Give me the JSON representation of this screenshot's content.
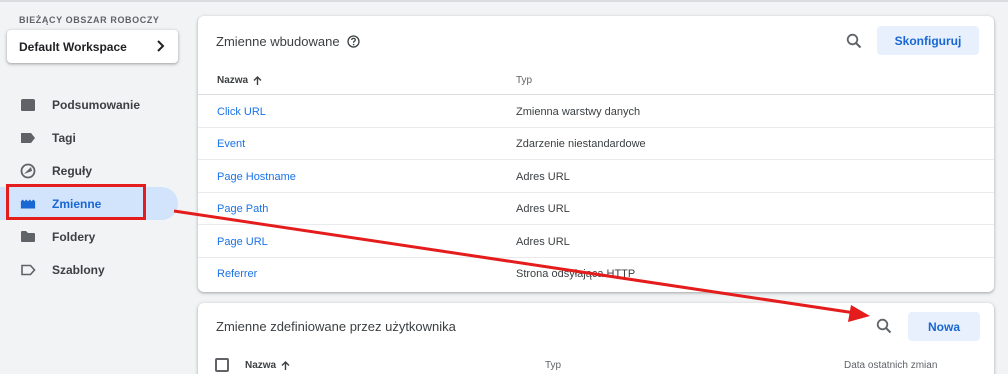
{
  "sidebar": {
    "workspace_label": "BIEŻĄCY OBSZAR ROBOCZY",
    "workspace_name": "Default Workspace",
    "items": [
      {
        "label": "Podsumowanie",
        "icon": "folder-filled-icon"
      },
      {
        "label": "Tagi",
        "icon": "tag-icon"
      },
      {
        "label": "Reguły",
        "icon": "trigger-icon"
      },
      {
        "label": "Zmienne",
        "icon": "variables-icon",
        "active": true
      },
      {
        "label": "Foldery",
        "icon": "folder-icon"
      },
      {
        "label": "Szablony",
        "icon": "template-label-icon"
      }
    ]
  },
  "builtin": {
    "title": "Zmienne wbudowane",
    "configure_label": "Skonfiguruj",
    "columns": {
      "name": "Nazwa",
      "type": "Typ"
    },
    "rows": [
      {
        "name": "Click URL",
        "type": "Zmienna warstwy danych"
      },
      {
        "name": "Event",
        "type": "Zdarzenie niestandardowe"
      },
      {
        "name": "Page Hostname",
        "type": "Adres URL"
      },
      {
        "name": "Page Path",
        "type": "Adres URL"
      },
      {
        "name": "Page URL",
        "type": "Adres URL"
      },
      {
        "name": "Referrer",
        "type": "Strona odsyłająca HTTP"
      }
    ]
  },
  "user_defined": {
    "title": "Zmienne zdefiniowane przez użytkownika",
    "new_label": "Nowa",
    "columns": {
      "name": "Nazwa",
      "type": "Typ",
      "date": "Data ostatnich zmian"
    }
  },
  "colors": {
    "accent": "#1a73e8",
    "annotation": "#e41c1c",
    "active_bg": "#d2e3fc"
  }
}
